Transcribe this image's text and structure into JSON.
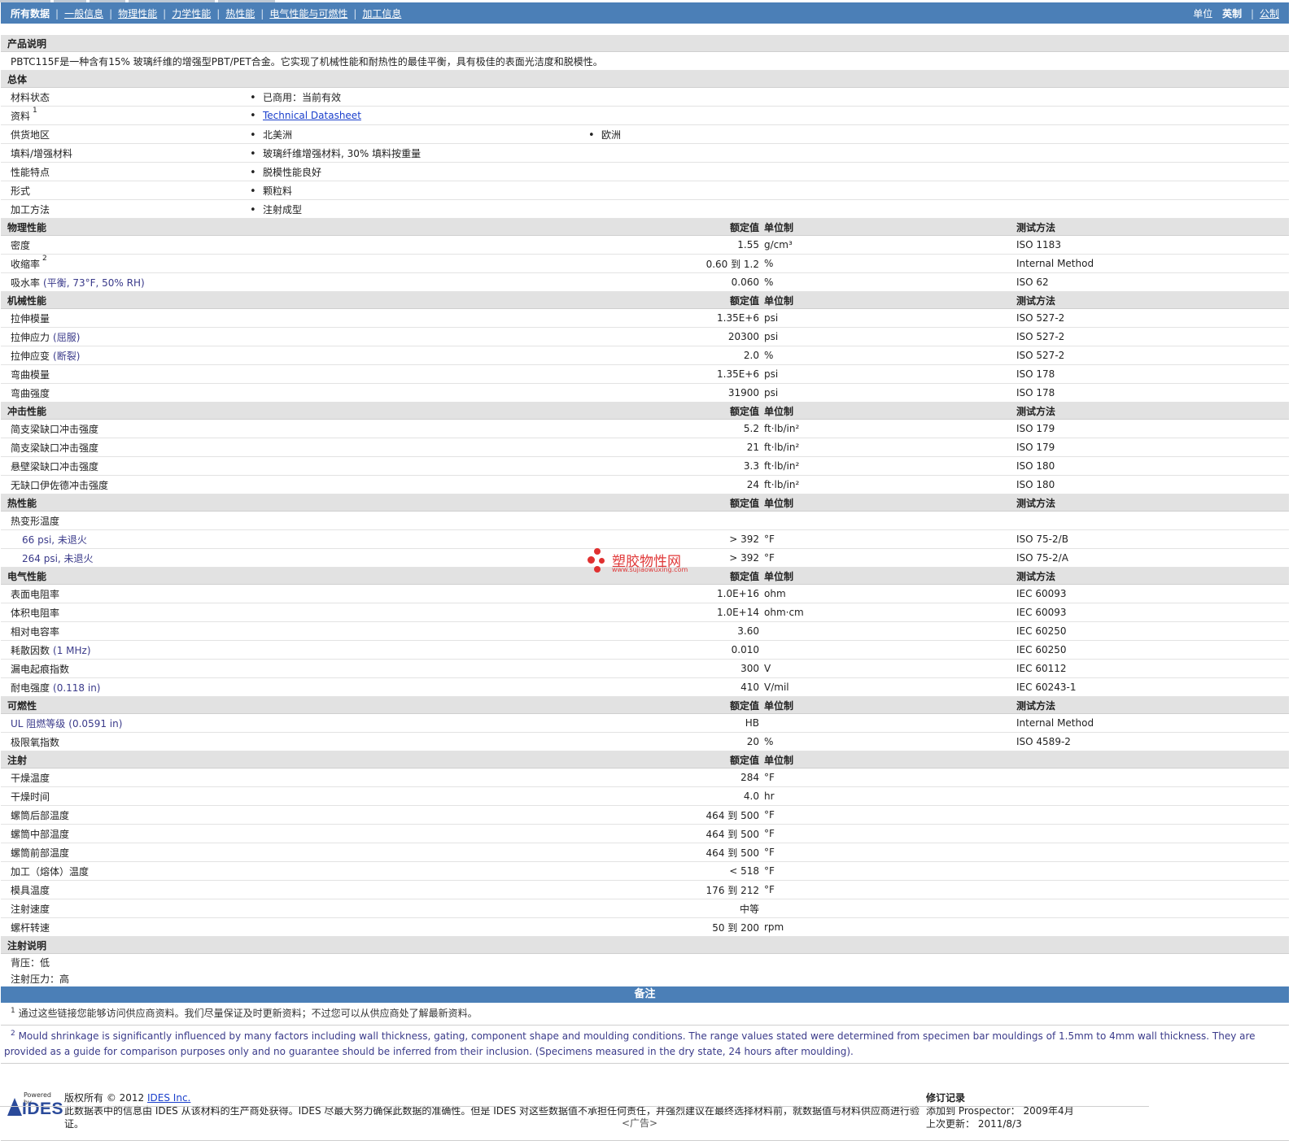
{
  "nav": {
    "links": [
      "所有数据",
      "一般信息",
      "物理性能",
      "力学性能",
      "热性能",
      "电气性能与可燃性",
      "加工信息"
    ],
    "units_label": "单位",
    "units_current": "英制",
    "units_alt": "公制"
  },
  "col": {
    "value": "额定值",
    "unit": "单位制",
    "method": "测试方法"
  },
  "desc": {
    "title": "产品说明",
    "text": "PBTC115F是一种含有15% 玻璃纤维的增强型PBT/PET合金。它实现了机械性能和耐热性的最佳平衡，具有极佳的表面光洁度和脱模性。"
  },
  "general": {
    "title": "总体",
    "rows": [
      {
        "label": "材料状态",
        "items": [
          "已商用：当前有效"
        ]
      },
      {
        "label": "资料",
        "sup": "1",
        "items": [
          "Technical Datasheet"
        ],
        "link": true
      },
      {
        "label": "供货地区",
        "items": [
          "北美洲",
          "欧洲"
        ]
      },
      {
        "label": "填料/增强材料",
        "items": [
          "玻璃纤维增强材料, 30% 填料按重量"
        ]
      },
      {
        "label": "性能特点",
        "items": [
          "脱模性能良好"
        ]
      },
      {
        "label": "形式",
        "items": [
          "颗粒料"
        ]
      },
      {
        "label": "加工方法",
        "items": [
          "注射成型"
        ]
      }
    ]
  },
  "sections": [
    {
      "title": "物理性能",
      "rows": [
        {
          "label": "密度",
          "value": "1.55",
          "unit": "g/cm³",
          "method": "ISO 1183"
        },
        {
          "label": "收缩率",
          "sup": "2",
          "value": "0.60 到  1.2",
          "unit": "%",
          "method": "Internal Method"
        },
        {
          "label": "吸水率",
          "cond": "(平衡, 73°F, 50% RH)",
          "value": "0.060",
          "unit": "%",
          "method": "ISO 62"
        }
      ]
    },
    {
      "title": "机械性能",
      "rows": [
        {
          "label": "拉伸模量",
          "value": "1.35E+6",
          "unit": "psi",
          "method": "ISO 527-2"
        },
        {
          "label": "拉伸应力",
          "cond": "(屈服)",
          "value": "20300",
          "unit": "psi",
          "method": "ISO 527-2"
        },
        {
          "label": "拉伸应变",
          "cond": "(断裂)",
          "value": "2.0",
          "unit": "%",
          "method": "ISO 527-2"
        },
        {
          "label": "弯曲模量",
          "value": "1.35E+6",
          "unit": "psi",
          "method": "ISO 178"
        },
        {
          "label": "弯曲强度",
          "value": "31900",
          "unit": "psi",
          "method": "ISO 178"
        }
      ]
    },
    {
      "title": "冲击性能",
      "rows": [
        {
          "label": "简支梁缺口冲击强度",
          "value": "5.2",
          "unit": "ft·lb/in²",
          "method": "ISO 179"
        },
        {
          "label": "简支梁缺口冲击强度",
          "value": "21",
          "unit": "ft·lb/in²",
          "method": "ISO 179"
        },
        {
          "label": "悬壁梁缺口冲击强度",
          "value": "3.3",
          "unit": "ft·lb/in²",
          "method": "ISO 180"
        },
        {
          "label": "无缺口伊佐德冲击强度",
          "value": "24",
          "unit": "ft·lb/in²",
          "method": "ISO 180"
        }
      ]
    },
    {
      "title": "热性能",
      "rows": [
        {
          "label": "热变形温度",
          "value": "",
          "unit": "",
          "method": ""
        },
        {
          "label": "66 psi, 未退火",
          "indent": true,
          "value": "> 392",
          "unit": "°F",
          "method": "ISO 75-2/B"
        },
        {
          "label": "264 psi, 未退火",
          "indent": true,
          "value": "> 392",
          "unit": "°F",
          "method": "ISO 75-2/A"
        }
      ]
    },
    {
      "title": "电气性能",
      "rows": [
        {
          "label": "表面电阻率",
          "value": "1.0E+16",
          "unit": "ohm",
          "method": "IEC 60093"
        },
        {
          "label": "体积电阻率",
          "value": "1.0E+14",
          "unit": "ohm·cm",
          "method": "IEC 60093"
        },
        {
          "label": "相对电容率",
          "value": "3.60",
          "unit": "",
          "method": "IEC 60250"
        },
        {
          "label": "耗散因数",
          "cond": "(1 MHz)",
          "value": "0.010",
          "unit": "",
          "method": "IEC 60250"
        },
        {
          "label": "漏电起痕指数",
          "value": "300",
          "unit": "V",
          "method": "IEC 60112"
        },
        {
          "label": "耐电强度",
          "cond": "(0.118 in)",
          "value": "410",
          "unit": "V/mil",
          "method": "IEC 60243-1"
        }
      ]
    },
    {
      "title": "可燃性",
      "rows": [
        {
          "label": "UL 阻燃等级",
          "labelCond": true,
          "cond": "(0.0591 in)",
          "value": "HB",
          "unit": "",
          "method": "Internal Method"
        },
        {
          "label": "极限氧指数",
          "value": "20",
          "unit": "%",
          "method": "ISO 4589-2"
        }
      ]
    },
    {
      "title": "注射",
      "noMethod": true,
      "rows": [
        {
          "label": "干燥温度",
          "value": "284",
          "unit": "°F",
          "method": ""
        },
        {
          "label": "干燥时间",
          "value": "4.0",
          "unit": "hr",
          "method": ""
        },
        {
          "label": "螺筒后部温度",
          "value": "464 到  500",
          "unit": "°F",
          "method": ""
        },
        {
          "label": "螺筒中部温度",
          "value": "464 到  500",
          "unit": "°F",
          "method": ""
        },
        {
          "label": "螺筒前部温度",
          "value": "464 到  500",
          "unit": "°F",
          "method": ""
        },
        {
          "label": "加工（熔体）温度",
          "value": "< 518",
          "unit": "°F",
          "method": ""
        },
        {
          "label": "模具温度",
          "value": "176 到  212",
          "unit": "°F",
          "method": ""
        },
        {
          "label": "注射速度",
          "value": "中等",
          "unit": "",
          "method": ""
        },
        {
          "label": "螺杆转速",
          "value": "50 到  200",
          "unit": "rpm",
          "method": ""
        }
      ]
    }
  ],
  "injection_notes": {
    "title": "注射说明",
    "lines": [
      "背压：低",
      "注射压力：高"
    ]
  },
  "notes": {
    "title": "备注",
    "n1": "通过这些链接您能够访问供应商资料。我们尽量保证及时更新资料；不过您可以从供应商处了解最新资料。",
    "n2": "Mould shrinkage is significantly influenced by many factors including wall thickness, gating, component shape and moulding conditions. The range values stated were determined from specimen bar mouldings of 1.5mm to 4mm wall thickness. They are provided as a guide for comparison purposes only and no guarantee should be inferred from their inclusion. (Specimens measured in the dry state, 24 hours after moulding)."
  },
  "footer": {
    "powered_by": "Powered by",
    "logo_text": "IDES",
    "copyright": "版权所有 © 2012",
    "company": "IDES Inc.",
    "disclaimer": "此数据表中的信息由 IDES 从该材料的生产商处获得。IDES 尽最大努力确保此数据的准确性。但是 IDES 对这些数据值不承担任何责任，并强烈建议在最终选择材料前，就数据值与材料供应商进行验证。",
    "rev_title": "修订记录",
    "added_label": "添加到 Prospector：",
    "added_value": "2009年4月",
    "updated_label": "上次更新：",
    "updated_value": "2011/8/3"
  },
  "ad_text": "<广告>",
  "watermark": {
    "text": "塑胶物性网",
    "url": "www.sujiaowuxing.com"
  },
  "colors": {
    "header_blue": "#4b7fb7",
    "section_gray": "#e2e2e2",
    "link": "#1a3fcc"
  }
}
